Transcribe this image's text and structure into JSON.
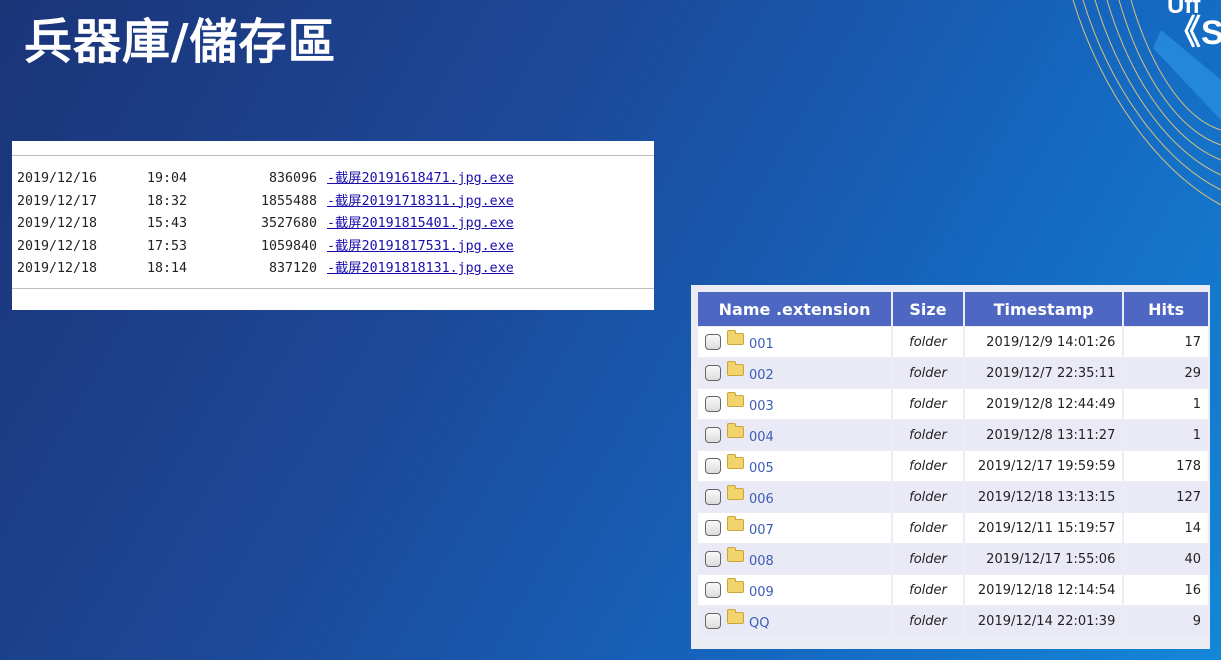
{
  "slide": {
    "title": "兵器庫/儲存區",
    "corner_line1": "Uff",
    "corner_line2": "《S"
  },
  "listing": {
    "rows": [
      {
        "date": "2019/12/16",
        "time": "19:04",
        "size": "836096",
        "file": "-截屏20191618471.jpg.exe"
      },
      {
        "date": "2019/12/17",
        "time": "18:32",
        "size": "1855488",
        "file": "-截屏20191718311.jpg.exe"
      },
      {
        "date": "2019/12/18",
        "time": "15:43",
        "size": "3527680",
        "file": "-截屏20191815401.jpg.exe"
      },
      {
        "date": "2019/12/18",
        "time": "17:53",
        "size": "1059840",
        "file": "-截屏20191817531.jpg.exe"
      },
      {
        "date": "2019/12/18",
        "time": "18:14",
        "size": "837120",
        "file": "-截屏20191818131.jpg.exe"
      }
    ]
  },
  "file_manager": {
    "headers": {
      "name": "Name .extension",
      "size": "Size",
      "timestamp": "Timestamp",
      "hits": "Hits"
    },
    "rows": [
      {
        "name": "001",
        "size": "folder",
        "timestamp": "2019/12/9 14:01:26",
        "hits": "17"
      },
      {
        "name": "002",
        "size": "folder",
        "timestamp": "2019/12/7 22:35:11",
        "hits": "29"
      },
      {
        "name": "003",
        "size": "folder",
        "timestamp": "2019/12/8 12:44:49",
        "hits": "1"
      },
      {
        "name": "004",
        "size": "folder",
        "timestamp": "2019/12/8 13:11:27",
        "hits": "1"
      },
      {
        "name": "005",
        "size": "folder",
        "timestamp": "2019/12/17 19:59:59",
        "hits": "178"
      },
      {
        "name": "006",
        "size": "folder",
        "timestamp": "2019/12/18 13:13:15",
        "hits": "127"
      },
      {
        "name": "007",
        "size": "folder",
        "timestamp": "2019/12/11 15:19:57",
        "hits": "14"
      },
      {
        "name": "008",
        "size": "folder",
        "timestamp": "2019/12/17 1:55:06",
        "hits": "40"
      },
      {
        "name": "009",
        "size": "folder",
        "timestamp": "2019/12/18 12:14:54",
        "hits": "16"
      },
      {
        "name": "QQ",
        "size": "folder",
        "timestamp": "2019/12/14 22:01:39",
        "hits": "9"
      }
    ],
    "icons": {
      "checkbox": "checkbox-icon",
      "folder": "folder-icon"
    },
    "colors": {
      "header_bg": "#4e67c2",
      "link": "#3b5db5"
    }
  }
}
